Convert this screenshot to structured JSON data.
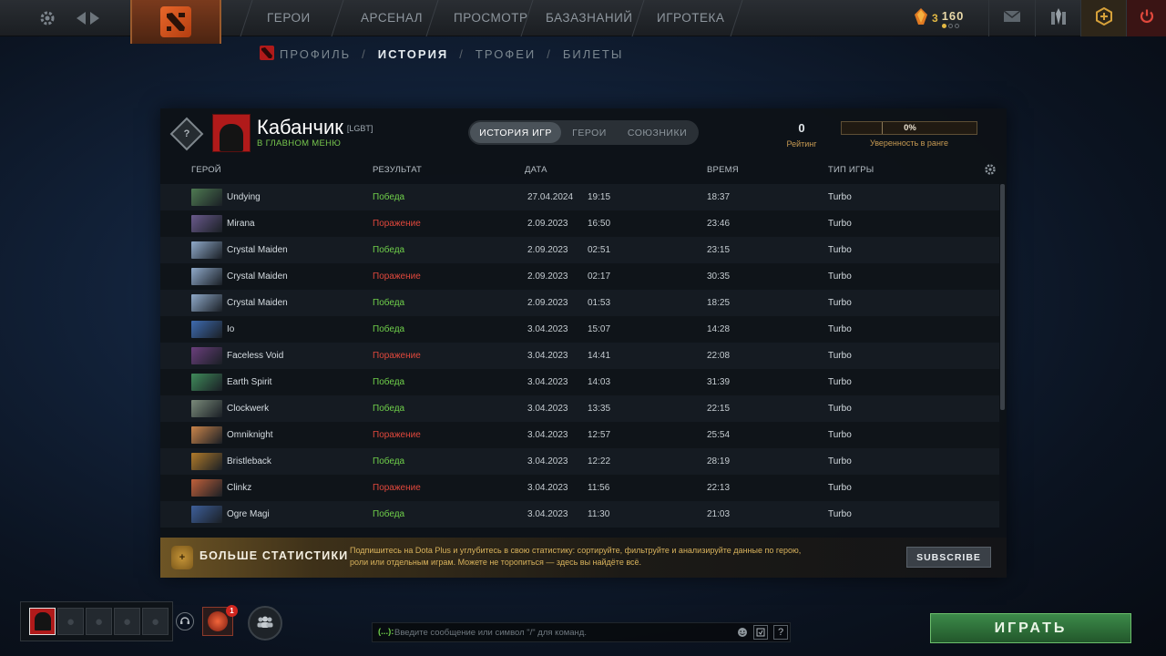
{
  "topbar": {
    "nav": [
      "ГЕРОИ",
      "АРСЕНАЛ",
      "ПРОСМОТР",
      "БАЗАЗНАНИЙ",
      "ИГРОТЕКА"
    ],
    "shards": "3",
    "gold": "160",
    "icons": {
      "settings": "gear-icon",
      "back": "arrow-left-icon",
      "forward": "arrow-right-icon",
      "mail": "mail-icon",
      "armory": "armory-icon",
      "dota_plus": "dota-plus-icon",
      "power": "power-icon"
    }
  },
  "profile_tabs": {
    "items": [
      "ПРОФИЛЬ",
      "ИСТОРИЯ",
      "ТРОФЕИ",
      "БИЛЕТЫ"
    ],
    "active": "ИСТОРИЯ",
    "separator": "/"
  },
  "player": {
    "rank_medal": "?",
    "name": "Кабанчик",
    "tag": "[LGBT]",
    "status": "В ГЛАВНОМ МЕНЮ"
  },
  "view_toggle": {
    "options": [
      "ИСТОРИЯ ИГР",
      "ГЕРОИ",
      "СОЮЗНИКИ"
    ],
    "active": "ИСТОРИЯ ИГР"
  },
  "rating": {
    "value": "0",
    "label": "Рейтинг"
  },
  "rank_confidence": {
    "value": "0%",
    "label": "Уверенность в ранге"
  },
  "table": {
    "columns": [
      "ГЕРОЙ",
      "РЕЗУЛЬТАТ",
      "ДАТА",
      "ВРЕМЯ",
      "ТИП ИГРЫ"
    ],
    "rows": [
      {
        "hero": "Undying",
        "result": "Победа",
        "outcome": "win",
        "date": "27.04.2024",
        "time": "19:15",
        "duration": "18:37",
        "type": "Turbo",
        "color": "#4f7a52"
      },
      {
        "hero": "Mirana",
        "result": "Поражение",
        "outcome": "loss",
        "date": "2.09.2023",
        "time": "16:50",
        "duration": "23:46",
        "type": "Turbo",
        "color": "#6a5a8c"
      },
      {
        "hero": "Crystal Maiden",
        "result": "Победа",
        "outcome": "win",
        "date": "2.09.2023",
        "time": "02:51",
        "duration": "23:15",
        "type": "Turbo",
        "color": "#8fa9c9"
      },
      {
        "hero": "Crystal Maiden",
        "result": "Поражение",
        "outcome": "loss",
        "date": "2.09.2023",
        "time": "02:17",
        "duration": "30:35",
        "type": "Turbo",
        "color": "#8fa9c9"
      },
      {
        "hero": "Crystal Maiden",
        "result": "Победа",
        "outcome": "win",
        "date": "2.09.2023",
        "time": "01:53",
        "duration": "18:25",
        "type": "Turbo",
        "color": "#8fa9c9"
      },
      {
        "hero": "Io",
        "result": "Победа",
        "outcome": "win",
        "date": "3.04.2023",
        "time": "15:07",
        "duration": "14:28",
        "type": "Turbo",
        "color": "#3e6bb0"
      },
      {
        "hero": "Faceless Void",
        "result": "Поражение",
        "outcome": "loss",
        "date": "3.04.2023",
        "time": "14:41",
        "duration": "22:08",
        "type": "Turbo",
        "color": "#6a3f7c"
      },
      {
        "hero": "Earth Spirit",
        "result": "Победа",
        "outcome": "win",
        "date": "3.04.2023",
        "time": "14:03",
        "duration": "31:39",
        "type": "Turbo",
        "color": "#3f8a5a"
      },
      {
        "hero": "Clockwerk",
        "result": "Победа",
        "outcome": "win",
        "date": "3.04.2023",
        "time": "13:35",
        "duration": "22:15",
        "type": "Turbo",
        "color": "#7a8a7a"
      },
      {
        "hero": "Omniknight",
        "result": "Поражение",
        "outcome": "loss",
        "date": "3.04.2023",
        "time": "12:57",
        "duration": "25:54",
        "type": "Turbo",
        "color": "#c9844a"
      },
      {
        "hero": "Bristleback",
        "result": "Победа",
        "outcome": "win",
        "date": "3.04.2023",
        "time": "12:22",
        "duration": "28:19",
        "type": "Turbo",
        "color": "#b07a2a"
      },
      {
        "hero": "Clinkz",
        "result": "Поражение",
        "outcome": "loss",
        "date": "3.04.2023",
        "time": "11:56",
        "duration": "22:13",
        "type": "Turbo",
        "color": "#c0603a"
      },
      {
        "hero": "Ogre Magi",
        "result": "Победа",
        "outcome": "win",
        "date": "3.04.2023",
        "time": "11:30",
        "duration": "21:03",
        "type": "Turbo",
        "color": "#3e5f9a"
      }
    ]
  },
  "dota_plus": {
    "title": "БОЛЬШЕ СТАТИСТИКИ",
    "description": "Подпишитесь на Dota Plus и углубитесь в свою статистику: сортируйте, фильтруйте и анализируйте данные по герою, роли или отдельным играм. Можете не торопиться — здесь вы найдёте всё.",
    "button": "SUBSCRIBE"
  },
  "bottom": {
    "event_badge": "1",
    "chat_prefix": "(...):",
    "chat_placeholder": "Введите сообщение или символ \"/\" для команд.",
    "help": "?",
    "play_button": "ИГРАТЬ"
  },
  "colors": {
    "win": "#6fcf4a",
    "loss": "#e0483c",
    "gold_label": "#c79a52",
    "play_green": "#3c8a4a"
  }
}
